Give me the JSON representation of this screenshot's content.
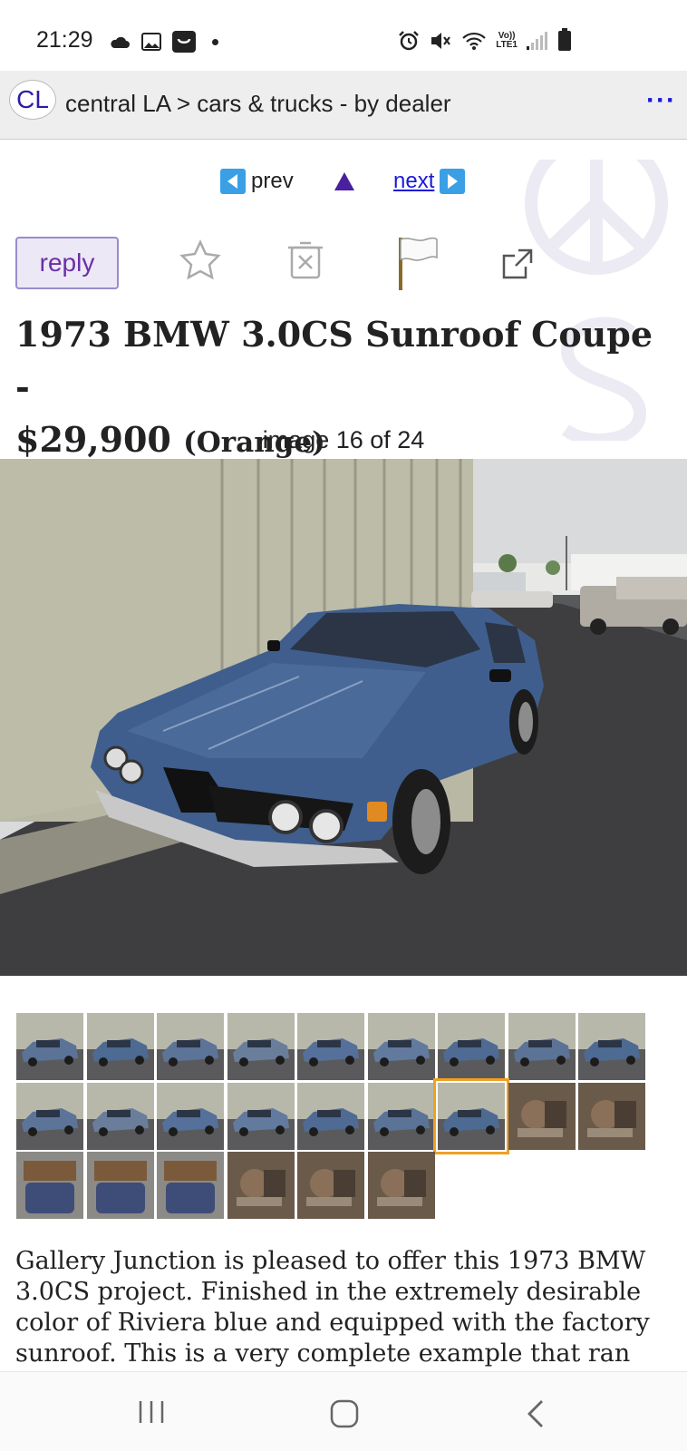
{
  "status_bar": {
    "time": "21:29",
    "left_icons": [
      "cloud-icon",
      "image-icon",
      "shopping-bag-icon",
      "notification-dot-icon"
    ],
    "right_icons": [
      "alarm-icon",
      "mute-icon",
      "wifi-icon",
      "volte-icon",
      "signal-icon",
      "battery-icon"
    ],
    "volte_top": "Vo))",
    "volte_bottom": "LTE1"
  },
  "header": {
    "logo": "CL",
    "breadcrumb": "central LA > cars & trucks - by dealer",
    "more": "···"
  },
  "nav": {
    "prev": "prev",
    "next": "next"
  },
  "actions": {
    "reply": "reply",
    "icons": [
      "star-icon",
      "hide-icon",
      "flag-icon",
      "share-icon"
    ]
  },
  "listing": {
    "title_line1": "1973 BMW 3.0CS Sunroof Coupe -",
    "price": "$29,900",
    "color_note": "(Orange)"
  },
  "gallery": {
    "counter": "image 16 of 24",
    "current_index": 16,
    "total": 24
  },
  "description": "Gallery Junction is pleased to offer this 1973 BMW 3.0CS project. Finished in the extremely desirable color of Riviera blue and equipped with the factory sunroof. This is a very complete example that ran",
  "bottom_nav": {
    "icons": [
      "recents-icon",
      "home-icon",
      "back-icon"
    ]
  },
  "colors": {
    "link": "#1a1ad8",
    "reply_text": "#6a2fa8",
    "selected_thumb": "#f0a024",
    "car_blue": "#3f5e8e"
  }
}
